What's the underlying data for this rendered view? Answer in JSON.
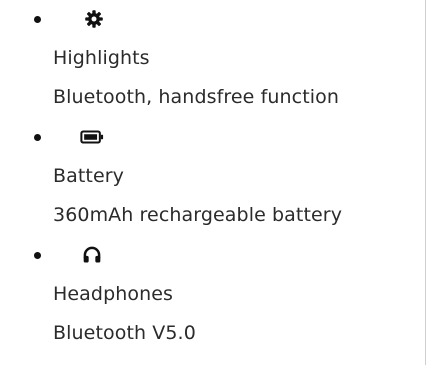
{
  "features": [
    {
      "icon": "gear-icon",
      "title": "Highlights",
      "detail": "Bluetooth, handsfree function"
    },
    {
      "icon": "battery-icon",
      "title": "Battery",
      "detail": "360mAh rechargeable battery"
    },
    {
      "icon": "headphones-icon",
      "title": "Headphones",
      "detail": "Bluetooth V5.0"
    }
  ],
  "colors": {
    "text": "#2b2b2b",
    "icon": "#111111",
    "rule": "#cfcfcf"
  }
}
